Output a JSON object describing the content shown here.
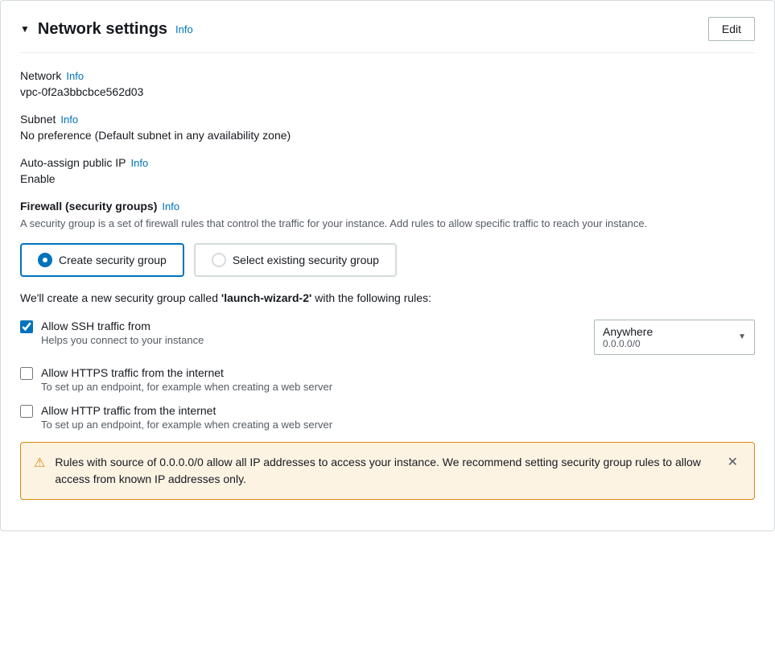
{
  "panel": {
    "title": "Network settings",
    "info_label": "Info",
    "edit_button_label": "Edit"
  },
  "network": {
    "label": "Network",
    "info_label": "Info",
    "value": "vpc-0f2a3bbcbce562d03"
  },
  "subnet": {
    "label": "Subnet",
    "info_label": "Info",
    "value": "No preference (Default subnet in any availability zone)"
  },
  "auto_assign_ip": {
    "label": "Auto-assign public IP",
    "info_label": "Info",
    "value": "Enable"
  },
  "firewall": {
    "label": "Firewall (security groups)",
    "info_label": "Info",
    "description": "A security group is a set of firewall rules that control the traffic for your instance. Add rules to allow specific traffic to reach your instance."
  },
  "radio_options": {
    "create": {
      "label": "Create security group",
      "selected": true
    },
    "select": {
      "label": "Select existing security group",
      "selected": false
    }
  },
  "new_sg_message": {
    "prefix": "We'll create a new security group called ",
    "sg_name": "'launch-wizard-2'",
    "suffix": " with the following rules:"
  },
  "ssh_rule": {
    "label": "Allow SSH traffic from",
    "description": "Helps you connect to your instance",
    "checked": true,
    "dropdown": {
      "top": "Anywhere",
      "sub": "0.0.0.0/0"
    }
  },
  "https_rule": {
    "label": "Allow HTTPS traffic from the internet",
    "description": "To set up an endpoint, for example when creating a web server",
    "checked": false
  },
  "http_rule": {
    "label": "Allow HTTP traffic from the internet",
    "description": "To set up an endpoint, for example when creating a web server",
    "checked": false
  },
  "warning": {
    "text": "Rules with source of 0.0.0.0/0 allow all IP addresses to access your instance. We recommend setting security group rules to allow access from known IP addresses only."
  }
}
